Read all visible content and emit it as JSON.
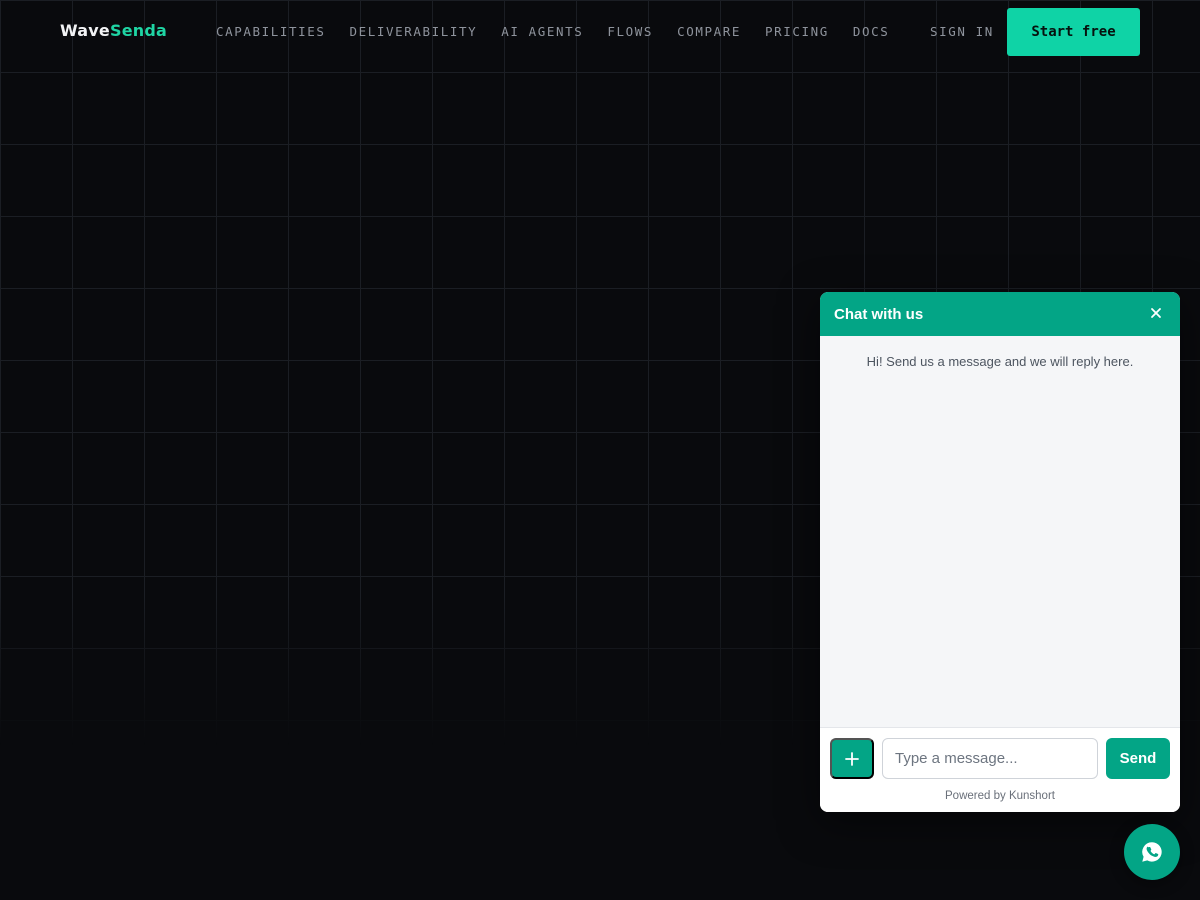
{
  "brand": {
    "part1": "Wave",
    "part2": "Senda",
    "accent": "#1fd5a4"
  },
  "nav": {
    "items": [
      "CAPABILITIES",
      "DELIVERABILITY",
      "AI AGENTS",
      "FLOWS",
      "COMPARE",
      "PRICING",
      "DOCS"
    ],
    "sign_in": "SIGN IN",
    "cta": "Start free"
  },
  "chat": {
    "title": "Chat with us",
    "close_icon": "close-icon",
    "greeting": "Hi! Send us a message and we will reply here.",
    "attach_label": "+",
    "input_placeholder": "Type a message...",
    "input_value": "",
    "send_label": "Send",
    "powered_by": "Powered by Kunshort",
    "accent": "#03a586"
  },
  "launcher": {
    "icon": "whatsapp-icon"
  }
}
